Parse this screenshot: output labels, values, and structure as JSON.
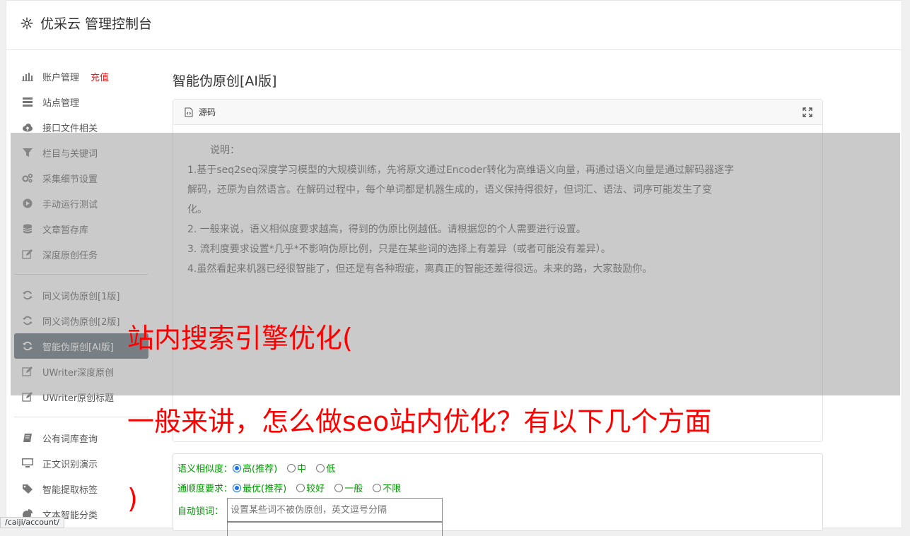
{
  "header": {
    "title": "优采云 管理控制台",
    "icon": "gear-icon"
  },
  "sidebar": {
    "group1": [
      {
        "label": "账户管理",
        "badge": "充值",
        "icon": "bar-chart-icon"
      },
      {
        "label": "站点管理",
        "icon": "server-icon"
      },
      {
        "label": "接口文件相关",
        "icon": "cloud-upload-icon"
      },
      {
        "label": "栏目与关键词",
        "icon": "filter-icon"
      },
      {
        "label": "采集细节设置",
        "icon": "gears-icon"
      },
      {
        "label": "手动运行测试",
        "icon": "play-circle-icon"
      },
      {
        "label": "文章暂存库",
        "icon": "database-icon"
      },
      {
        "label": "深度原创任务",
        "icon": "edit-icon"
      }
    ],
    "group2": [
      {
        "label": "同义词伪原创[1版]",
        "icon": "refresh-icon"
      },
      {
        "label": "同义词伪原创[2版]",
        "icon": "refresh-icon"
      },
      {
        "label": "智能伪原创[AI版]",
        "icon": "refresh-icon",
        "active": true
      },
      {
        "label": "UWriter深度原创",
        "icon": "edit-icon"
      },
      {
        "label": "UWriter原创标题",
        "icon": "edit-icon"
      }
    ],
    "group3": [
      {
        "label": "公有词库查询",
        "icon": "book-icon"
      },
      {
        "label": "正文识别演示",
        "icon": "monitor-icon"
      },
      {
        "label": "智能提取标签",
        "icon": "tag-icon"
      },
      {
        "label": "文本智能分类",
        "icon": "pie-chart-icon"
      }
    ]
  },
  "main": {
    "title": "智能伪原创[AI版]",
    "panel": {
      "tab_label": "源码",
      "lead": "说明：",
      "lines": [
        "1.基于seq2seq深度学习模型的大规模训练，先将原文通过Encoder转化为高维语义向量，再通过语义向量是通过解码器逐字",
        "解码，还原为自然语言。在解码过程中，每个单词都是机器生成的，语义保持得很好，但词汇、语法、词序可能发生了变",
        "化。",
        "2. 一般来说，语义相似度要求越高，得到的伪原比例越低。请根据您的个人需要进行设置。",
        "3. 流利度要求设置*几乎*不影响伪原比例，只是在某些词的选择上有差异（或者可能没有差异）。",
        "4.虽然看起来机器已经很智能了，但还是有各种瑕疵，离真正的智能还差得很远。未来的路，大家鼓励你。"
      ]
    }
  },
  "overlay": {
    "line1": "站内搜索引擎优化(",
    "line2": "一般来讲，怎么做seo站内优化？有以下几个方面",
    "line3": ")"
  },
  "form": {
    "similarity": {
      "label": "语义相似度：",
      "options": [
        "高(推荐)",
        "中",
        "低"
      ],
      "selected": 0
    },
    "fluency": {
      "label": "通顺度要求：",
      "options": [
        "最优(推荐)",
        "较好",
        "一般",
        "不限"
      ],
      "selected": 0
    },
    "lock": {
      "label": "自动锁词：",
      "placeholder": "设置某些词不被伪原创，英文逗号分隔"
    }
  },
  "status_url": "/caiji/account/",
  "colors": {
    "accent_red": "#ff0000",
    "active_nav": "#5a6873",
    "form_label": "#009900",
    "badge_red": "#e02020"
  }
}
